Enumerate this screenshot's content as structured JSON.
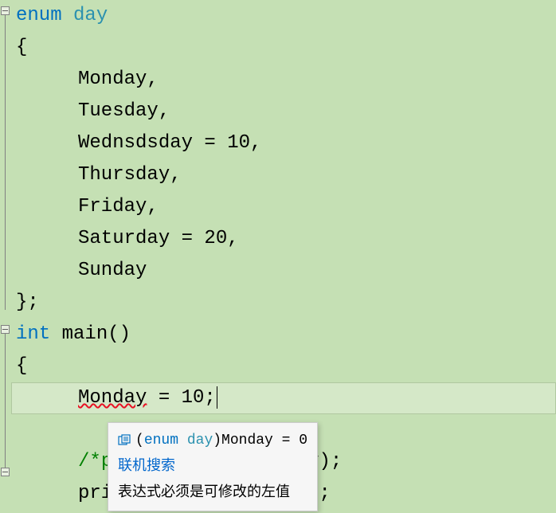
{
  "code": {
    "line1": {
      "kw": "enum",
      "type": "day"
    },
    "line2": "{",
    "line3": "Monday,",
    "line4": "Tuesday,",
    "line5": "Wednsdsday = 10,",
    "line6": "Thursday,",
    "line7": "Friday,",
    "line8": "Saturday = 20,",
    "line9": "Sunday",
    "line10": "};",
    "line11": {
      "kw": "int",
      "name": "main",
      "paren": "()"
    },
    "line12": "{",
    "line13": {
      "err": "Monday",
      "rest": " = 10;"
    },
    "line14": "",
    "line15": {
      "cm_open": "/*",
      "txt": "p",
      "rest": "nday);"
    },
    "line16": {
      "txt": "pri",
      "rest": "day);"
    }
  },
  "tooltip": {
    "sig_prefix": "(",
    "sig_kw": "enum",
    "sig_type": "day",
    "sig_suffix": ")Monday = 0",
    "link": "联机搜索",
    "error": "表达式必须是可修改的左值"
  }
}
